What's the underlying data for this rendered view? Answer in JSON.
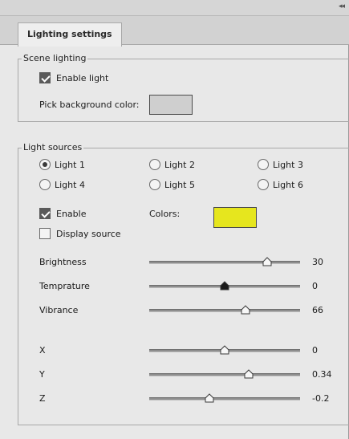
{
  "panel": {
    "collapse_glyph": "◂◂",
    "tab_label": "Lighting settings"
  },
  "scene": {
    "legend": "Scene lighting",
    "enable_label": "Enable light",
    "enable_checked": true,
    "bg_label": "Pick background color:",
    "bg_color": "#cfcfcf"
  },
  "sources": {
    "legend": "Light sources",
    "lights": [
      {
        "label": "Light 1",
        "selected": true
      },
      {
        "label": "Light 2",
        "selected": false
      },
      {
        "label": "Light 3",
        "selected": false
      },
      {
        "label": "Light 4",
        "selected": false
      },
      {
        "label": "Light 5",
        "selected": false
      },
      {
        "label": "Light 6",
        "selected": false
      }
    ],
    "enable_label": "Enable",
    "enable_checked": true,
    "display_label": "Display source",
    "display_checked": false,
    "colors_label": "Colors:",
    "light_color": "#e6e61e"
  },
  "sliders": [
    {
      "label": "Brightness",
      "value": "30",
      "position": 0.78,
      "active": false
    },
    {
      "label": "Temprature",
      "value": "0",
      "position": 0.5,
      "active": true
    },
    {
      "label": "Vibrance",
      "value": "66",
      "position": 0.64,
      "active": false
    },
    {
      "label": "X",
      "value": "0",
      "position": 0.5,
      "active": false
    },
    {
      "label": "Y",
      "value": "0.34",
      "position": 0.66,
      "active": false
    },
    {
      "label": "Z",
      "value": "-0.2",
      "position": 0.4,
      "active": false
    }
  ]
}
